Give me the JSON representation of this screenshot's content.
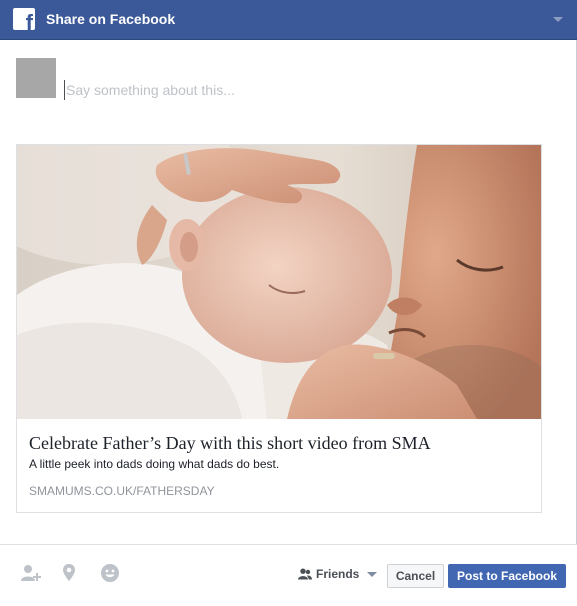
{
  "header": {
    "logo_letter": "f",
    "title": "Share on Facebook"
  },
  "composer": {
    "placeholder": "Say something about this...",
    "value": ""
  },
  "link_card": {
    "title": "Celebrate Father’s Day with this short video from SMA",
    "description": "A little peek into dads doing what dads do best.",
    "domain": "SMAMUMS.CO.UK/FATHERSDAY"
  },
  "footer": {
    "icons": [
      "tag-friends-icon",
      "location-pin-icon",
      "feeling-smiley-icon"
    ],
    "audience_label": "Friends",
    "cancel_label": "Cancel",
    "post_label": "Post to Facebook"
  },
  "colors": {
    "brand": "#3b5998",
    "post_button": "#4267b2",
    "muted_text": "#90949c"
  }
}
